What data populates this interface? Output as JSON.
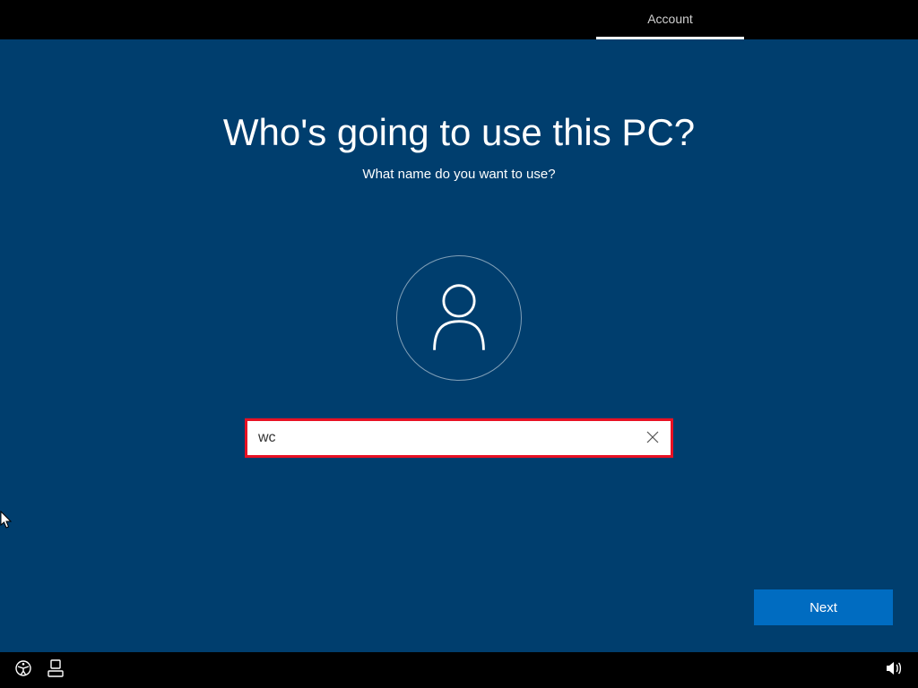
{
  "topbar": {
    "tab_label": "Account"
  },
  "main": {
    "title": "Who's going to use this PC?",
    "subtitle": "What name do you want to use?",
    "username_value": "wc",
    "next_label": "Next"
  },
  "colors": {
    "background": "#003e6e",
    "accent": "#006cc1",
    "highlight_border": "#e81123"
  }
}
